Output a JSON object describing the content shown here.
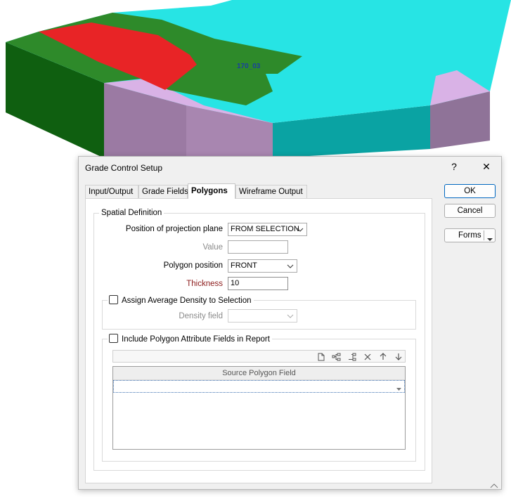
{
  "scene": {
    "label_main": "170_03",
    "colors": {
      "cyan": "#27e4e4",
      "green": "#2e8a2a",
      "dark_green": "#0f5f10",
      "red": "#e82426",
      "lilac": "#d9b2e6",
      "purple": "#9b7aa3"
    }
  },
  "dialog": {
    "title": "Grade Control Setup",
    "help_label": "?",
    "close_label": "✕",
    "tabs": [
      {
        "label": "Input/Output"
      },
      {
        "label": "Grade Fields"
      },
      {
        "label": "Polygons"
      },
      {
        "label": "Wireframe Output"
      }
    ],
    "spatial": {
      "legend": "Spatial Definition",
      "projection_label": "Position of projection plane",
      "projection_value": "FROM SELECTION",
      "value_label": "Value",
      "value_value": "",
      "polygon_position_label": "Polygon position",
      "polygon_position_value": "FRONT",
      "thickness_label": "Thickness",
      "thickness_value": "10"
    },
    "density": {
      "checkbox_label": "Assign Average Density to Selection",
      "field_label": "Density field",
      "field_value": ""
    },
    "attributes": {
      "checkbox_label": "Include Polygon Attribute Fields in Report",
      "column_header": "Source Polygon Field",
      "row_value": ""
    },
    "buttons": {
      "ok": "OK",
      "cancel": "Cancel",
      "forms": "Forms"
    }
  }
}
